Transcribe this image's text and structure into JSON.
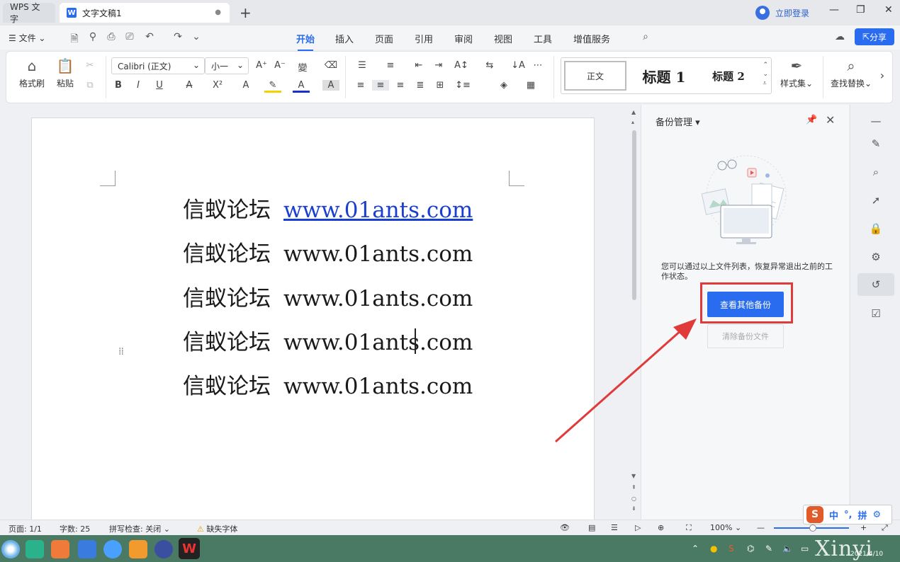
{
  "app": {
    "product_tab": "WPS 文字",
    "doc_tab": "文字文稿1",
    "login": "立即登录",
    "share": "分享"
  },
  "menu": {
    "file": "文件",
    "tabs": [
      "开始",
      "插入",
      "页面",
      "引用",
      "审阅",
      "视图",
      "工具",
      "增值服务"
    ],
    "active_tab": "开始"
  },
  "ribbon": {
    "format_painter": "格式刷",
    "paste": "粘贴",
    "font_name": "Calibri (正文)",
    "font_size": "小一",
    "styles": {
      "normal": "正文",
      "heading1": "标题 1",
      "heading2": "标题 2"
    },
    "style_set": "样式集",
    "find_replace": "查找替换"
  },
  "document": {
    "lines": [
      {
        "cn": "信蚁论坛",
        "url": "www.01ants.com"
      },
      {
        "cn": "信蚁论坛",
        "url": "www.01ants.com"
      },
      {
        "cn": "信蚁论坛",
        "url": "www.01ants.com"
      },
      {
        "cn": "信蚁论坛",
        "url": "www.01ants.com"
      },
      {
        "cn": "信蚁论坛",
        "url": "www.01ants.com"
      }
    ]
  },
  "backup_panel": {
    "title": "备份管理",
    "description": "您可以通过以上文件列表，恢复异常退出之前的工作状态。",
    "view_other": "查看其他备份",
    "clear": "清除备份文件"
  },
  "status": {
    "page": "页面: 1/1",
    "words": "字数: 25",
    "spell": "拼写检查: 关闭",
    "missing_font": "缺失字体",
    "zoom": "100%"
  },
  "ime": {
    "lang": "中",
    "mode": "拼"
  },
  "taskbar": {
    "watermark": "Xinyi",
    "date": "2021/4/10"
  },
  "colors": {
    "accent": "#2a6cf0",
    "highlight_frame": "#e03a3a",
    "arrow": "#e03a3a"
  }
}
